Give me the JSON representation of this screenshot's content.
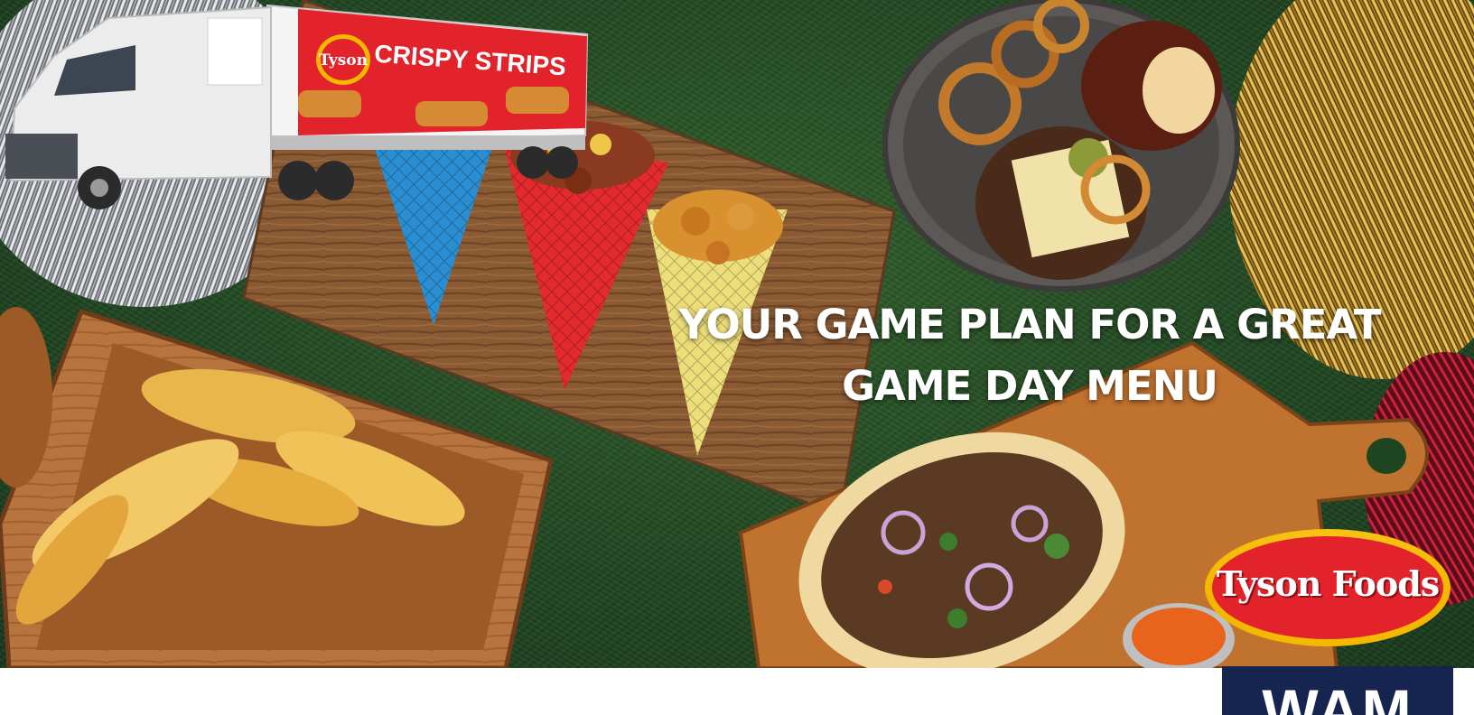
{
  "headline": {
    "line1": "YOUR GAME PLAN FOR A GREAT",
    "line2": "GAME DAY MENU"
  },
  "brand_logo": {
    "text": "Tyson Foods"
  },
  "truck": {
    "trailer_brand": "Tyson",
    "trailer_product": "CRISPY STRIPS"
  },
  "footer_badge": {
    "text": "WAM"
  },
  "colors": {
    "turf": "#1f4520",
    "tyson_red": "#e3232c",
    "tyson_yellow": "#f5b800",
    "badge_navy": "#16254f",
    "headline_text": "#ffffff"
  }
}
